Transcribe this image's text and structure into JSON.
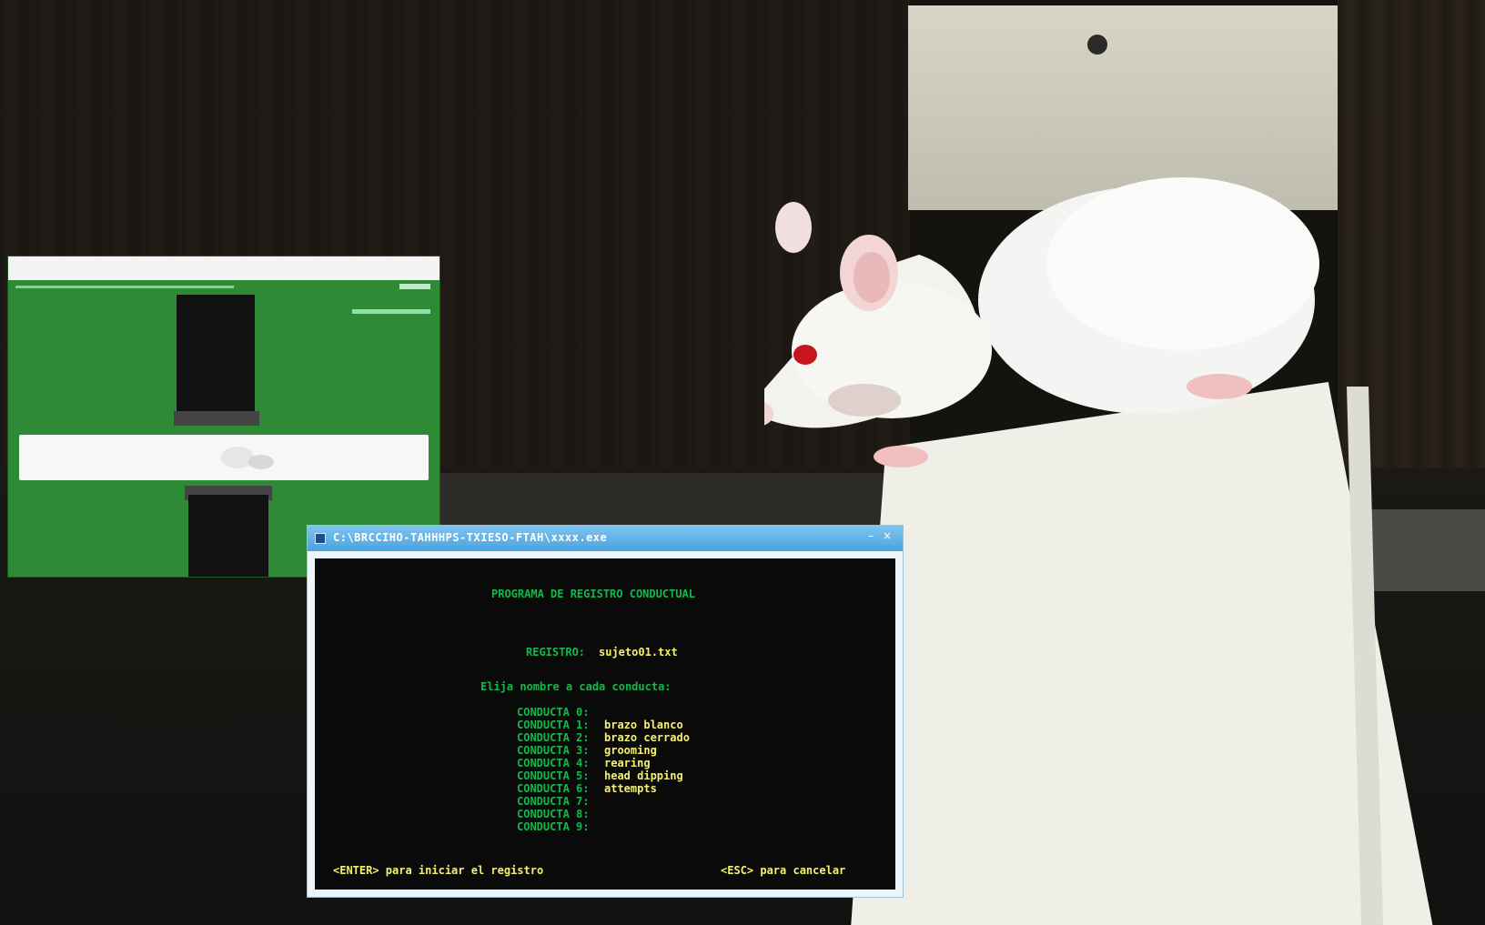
{
  "console": {
    "title": "C:\\BRCCIHO-TAHHHPS-TXIESO-FTAH\\xxxx.exe",
    "minimize_glyph": "–",
    "close_glyph": "×",
    "heading": "PROGRAMA DE REGISTRO CONDUCTUAL",
    "file_label": "REGISTRO:",
    "file_value": "sujeto01.txt",
    "prompt": "Elija nombre a cada conducta:",
    "behaviors": [
      {
        "code": "CONDUCTA 0:",
        "name": ""
      },
      {
        "code": "CONDUCTA 1:",
        "name": "brazo blanco"
      },
      {
        "code": "CONDUCTA 2:",
        "name": "brazo cerrado"
      },
      {
        "code": "CONDUCTA 3:",
        "name": "grooming"
      },
      {
        "code": "CONDUCTA 4:",
        "name": "rearing"
      },
      {
        "code": "CONDUCTA 5:",
        "name": "head dipping"
      },
      {
        "code": "CONDUCTA 6:",
        "name": "attempts"
      },
      {
        "code": "CONDUCTA 7:",
        "name": ""
      },
      {
        "code": "CONDUCTA 8:",
        "name": ""
      },
      {
        "code": "CONDUCTA 9:",
        "name": ""
      }
    ],
    "footer_left": "<ENTER> para iniciar el registro",
    "footer_right": "<ESC> para cancelar"
  },
  "tracker": {
    "window": "elevated-maze-tracking-view",
    "background_color": "#2f8a36"
  },
  "icons": {
    "console_app": "console-app-icon",
    "minimize": "minimize-icon",
    "close": "close-icon"
  }
}
